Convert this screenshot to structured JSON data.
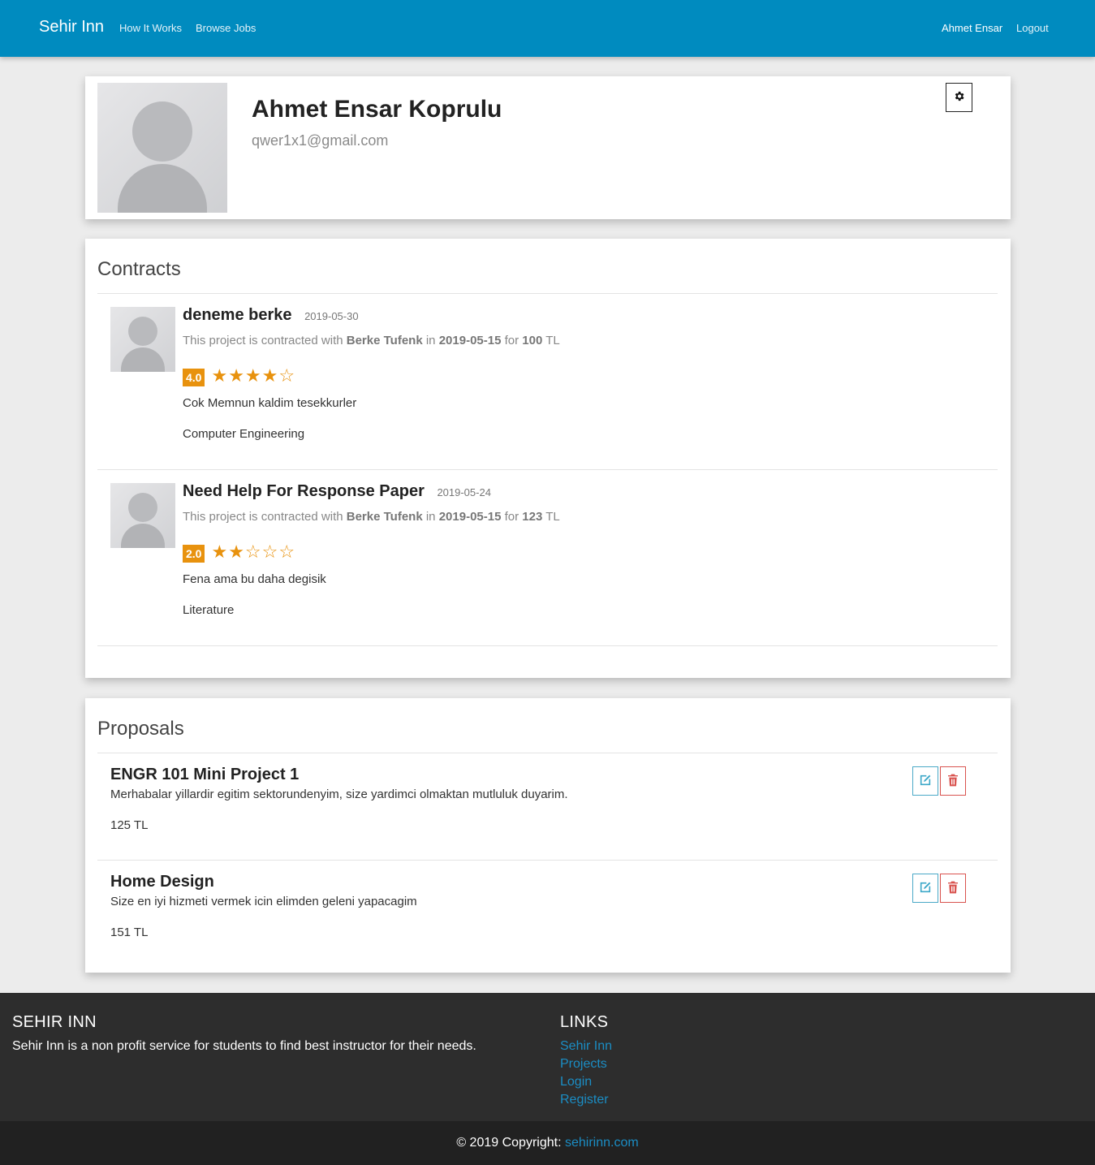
{
  "navbar": {
    "brand": "Sehir Inn",
    "links": [
      "How It Works",
      "Browse Jobs"
    ],
    "user": "Ahmet Ensar",
    "logout": "Logout",
    "color": "#008bbf"
  },
  "profile": {
    "name": "Ahmet Ensar Koprulu",
    "email": "qwer1x1@gmail.com",
    "settings_icon": "gear-icon"
  },
  "contracts": {
    "title": "Contracts",
    "items": [
      {
        "title": "deneme berke",
        "date": "2019-05-30",
        "prefix": "This project is contracted with",
        "person": "Berke Tufenk",
        "in": "in",
        "contract_date": "2019-05-15",
        "for": "for",
        "amount": "100",
        "currency": "TL",
        "rating": "4.0",
        "stars": "★★★★☆",
        "comment": "Cok Memnun kaldim tesekkurler",
        "category": "Computer Engineering"
      },
      {
        "title": "Need Help For Response Paper",
        "date": "2019-05-24",
        "prefix": "This project is contracted with",
        "person": "Berke Tufenk",
        "in": "in",
        "contract_date": "2019-05-15",
        "for": "for",
        "amount": "123",
        "currency": "TL",
        "rating": "2.0",
        "stars": "★★☆☆☆",
        "comment": "Fena ama bu daha degisik",
        "category": "Literature"
      }
    ]
  },
  "proposals": {
    "title": "Proposals",
    "items": [
      {
        "title": "ENGR 101 Mini Project 1",
        "description": "Merhabalar yillardir egitim sektorundenyim, size yardimci olmaktan mutluluk duyarim.",
        "price": "125 TL"
      },
      {
        "title": "Home Design",
        "description": "Size en iyi hizmeti vermek icin elimden geleni yapacagim",
        "price": "151 TL"
      }
    ]
  },
  "footer": {
    "about_heading": "SEHIR INN",
    "about_text": "Sehir Inn is a non profit service for students to find best instructor for their needs.",
    "links_heading": "LINKS",
    "links": [
      "Sehir Inn",
      "Projects",
      "Login",
      "Register"
    ],
    "copyright_text": "© 2019 Copyright:",
    "copyright_link": "sehirinn.com"
  },
  "colors": {
    "accent": "#008bbf",
    "rating": "#e8920e",
    "edit": "#4aa9c7",
    "delete": "#d9534f"
  }
}
